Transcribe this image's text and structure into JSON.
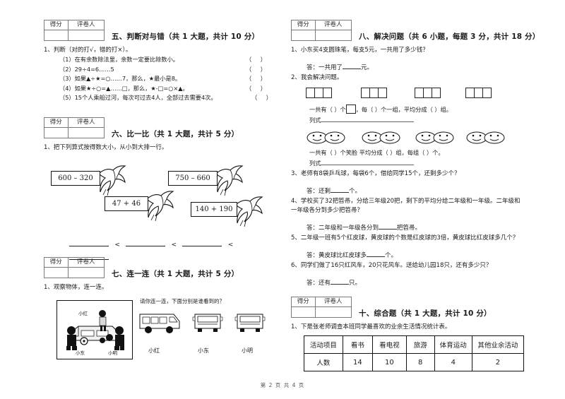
{
  "document": {
    "footer": "第 2 页 共 4 页",
    "score_box": {
      "score_label": "得分",
      "grader_label": "评卷人"
    }
  },
  "sections": {
    "sec5": {
      "title": "五、判断对与错（共 1 大题，共计 10 分）",
      "q1": "1、判断（对的打√，错的打×）。",
      "items": [
        {
          "text": "（1）在有余数除法里，余数一定要比除数小。",
          "mark": "（   ）"
        },
        {
          "text": "（2）29÷4=6……5",
          "mark": "（   ）"
        },
        {
          "text": "（3）如果▲÷★=○……7，那么，★最小是8。",
          "mark": "（   ）"
        },
        {
          "text": "（4）如果★÷○=▲……□，那么，★-□=○×▲。",
          "mark": "（   ）"
        },
        {
          "text": "（5）15个人乘船过河，每次可过去4人，全部过去需要4次。",
          "mark": "（   ）"
        }
      ]
    },
    "sec6": {
      "title": "六、比一比（共 1 大题，共计 5 分）",
      "q1": "1、把下列算式按得数大小，从小到大排一行。",
      "cards": [
        "600 – 320",
        "750 – 660",
        "47 + 46",
        "140 + 190"
      ],
      "compare_sign": "<"
    },
    "sec7": {
      "title": "七、连一连（共 1 大题，共计 5 分）",
      "q1": "1、观察物体，连一连。",
      "caption": "请你连一连，下面分别是谁看到的？",
      "photo_labels": [
        "小红",
        "小东",
        "小明"
      ],
      "vehicle_names": [
        "小红",
        "小东",
        "小明"
      ]
    },
    "sec8": {
      "title": "八、解决问题（共 6 小题，每题 3 分，共计 18 分）",
      "q1": "1、小东买4支圆珠笔，每支5元，一共用了多少钱？",
      "a1_pre": "答：一共用了",
      "a1_post": "元。",
      "q2": "2、我会解决问题。",
      "sq_groups": 4,
      "sq_per_group": 3,
      "fill1_a": "一共有（    ）个",
      "fill1_b": "，每（     ）个一组，平均分成（     ）组。",
      "lishi_label": "列式",
      "smile_groups": 4,
      "smile_per_group": 2,
      "fill2": "一共有（     ）个笑脸  平均分成（     ）组，每组（     ）个。",
      "q3": "3、老师有8袋乒乓球，每袋6个，借给同学15个，还剩多少个？",
      "a3_pre": "答：还剩",
      "a3_post": "个。",
      "q4": "4、学校买了32把笤帚，分给三年级20把，剩下的平均分给二年级和一年级。二年级和一年级各分到多少把笤帚？",
      "a4_pre": "答：二年级和一年级各分到",
      "a4_post": "把笤帚。",
      "q5": "5、二年级一班有5个红皮球，黄皮球的个数是红皮球的3倍，黄皮球比红皮球多几个？",
      "a5_pre": "答：黄皮球比红皮球多",
      "a5_post": "个。",
      "q6": "6、同学们做了16只红风车，20只花风车。送给幼儿园18只，还有多少只？",
      "a6_pre": "答：还有",
      "a6_post": "只。"
    },
    "sec10": {
      "title": "十、综合题（共 1 大题，共计 10 分）",
      "q1": "1、下是张老师调查本班同学最喜欢的业余生活情况统计表。",
      "table": {
        "row_headers": [
          "活动项目",
          "人数"
        ],
        "columns": [
          "看书",
          "看电视",
          "旅游",
          "体育运动",
          "其他业余活动"
        ],
        "values": [
          "14",
          "10",
          "8",
          "4",
          "2"
        ]
      }
    }
  },
  "colors": {
    "ink": "#1a1a1a",
    "rule": "#7a7a7a",
    "border": "#111111"
  }
}
